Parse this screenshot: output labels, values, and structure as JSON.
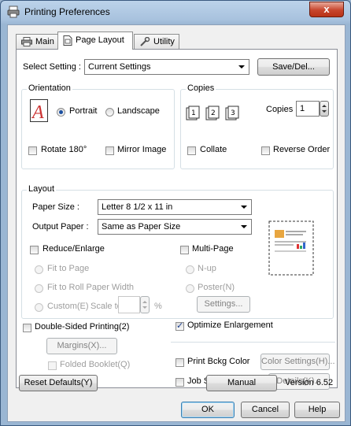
{
  "window": {
    "title": "Printing Preferences",
    "close_label": "x"
  },
  "tabs": [
    {
      "label": "Main"
    },
    {
      "label": "Page Layout"
    },
    {
      "label": "Utility"
    }
  ],
  "select_setting": {
    "label": "Select Setting :",
    "value": "Current Settings",
    "save_del": "Save/Del..."
  },
  "orientation": {
    "title": "Orientation",
    "portrait": "Portrait",
    "landscape": "Landscape",
    "rotate180": "Rotate 180°",
    "mirror": "Mirror Image"
  },
  "copies": {
    "title": "Copies",
    "label": "Copies",
    "value": "1",
    "collate": "Collate",
    "reverse": "Reverse Order"
  },
  "layout": {
    "title": "Layout",
    "paper_size_label": "Paper Size :",
    "paper_size_value": "Letter 8 1/2 x 11 in",
    "output_paper_label": "Output Paper :",
    "output_paper_value": "Same as Paper Size",
    "reduce_enlarge": "Reduce/Enlarge",
    "fit_to_page": "Fit to Page",
    "fit_to_roll": "Fit to Roll Paper Width",
    "custom": "Custom(E)",
    "scale_to": "Scale to",
    "percent": "%",
    "multi_page": "Multi-Page",
    "n_up": "N-up",
    "poster": "Poster(N)",
    "settings": "Settings..."
  },
  "double_sided": {
    "label": "Double-Sided Printing(2)",
    "margins": "Margins(X)...",
    "folded_booklet": "Folded Booklet(Q)"
  },
  "optimize_enlargement": "Optimize Enlargement",
  "print_bckg": {
    "label": "Print Bckg Color",
    "button": "Color Settings(H)..."
  },
  "job_settings": {
    "label": "Job Settings",
    "button": "Details(K)..."
  },
  "bottom": {
    "reset": "Reset Defaults(Y)",
    "manual": "Manual",
    "version": "Version 6.52"
  },
  "dialog_buttons": {
    "ok": "OK",
    "cancel": "Cancel",
    "help": "Help"
  }
}
